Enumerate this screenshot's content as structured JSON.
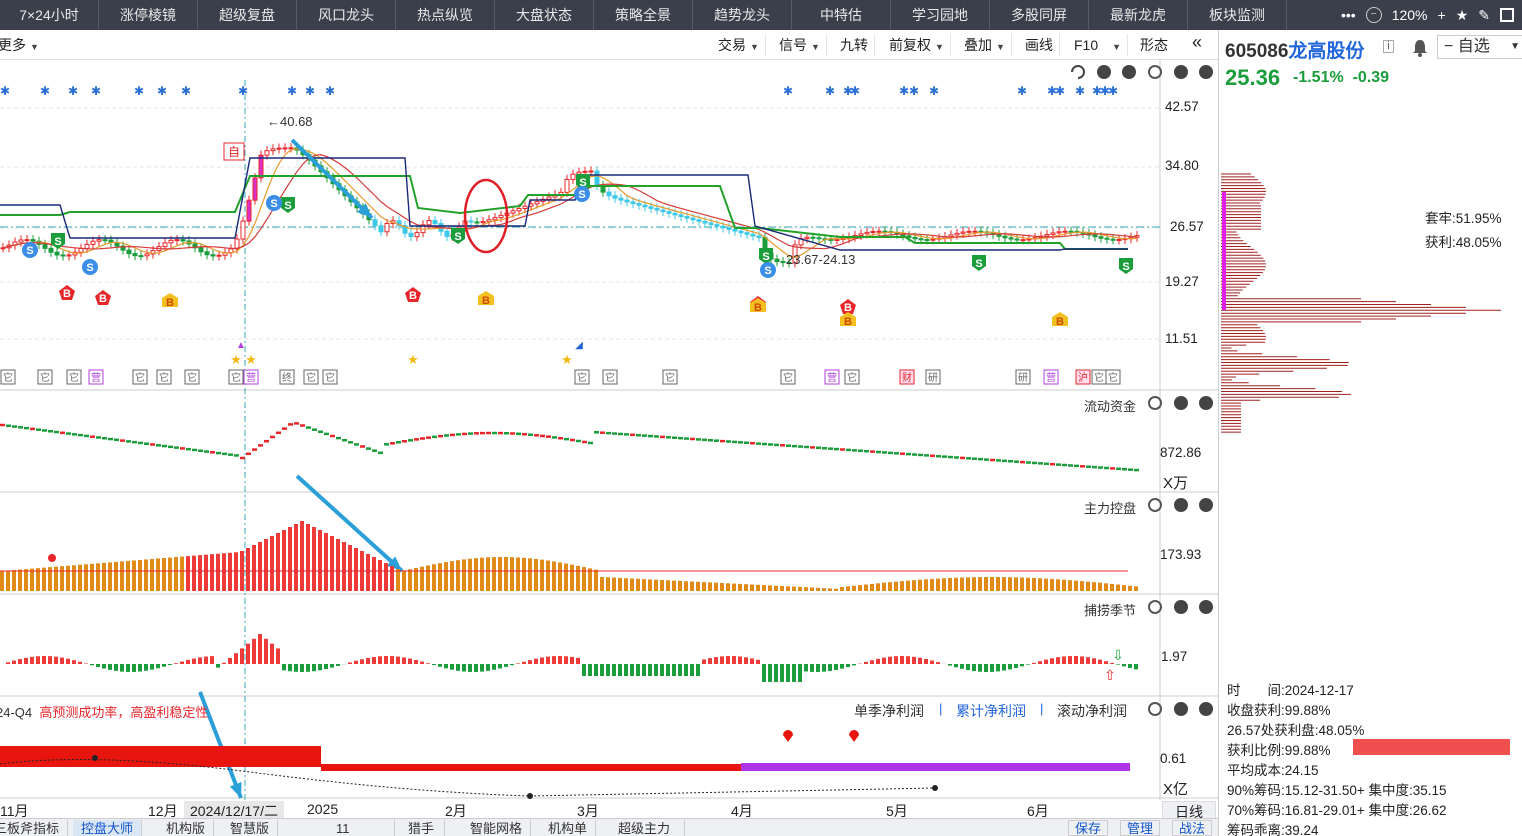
{
  "topnav": {
    "items": [
      "7×24小时",
      "涨停棱镜",
      "超级复盘",
      "风口龙头",
      "热点纵览",
      "大盘状态",
      "策略全景",
      "趋势龙头",
      "中特估",
      "学习园地",
      "多股同屏",
      "最新龙虎",
      "板块监测"
    ],
    "zoom": "120%"
  },
  "toolbar": {
    "more": "更多",
    "items": [
      "交易",
      "信号",
      "九转",
      "前复权",
      "叠加",
      "画线",
      "F10",
      "形态"
    ]
  },
  "stock": {
    "code": "605086",
    "name": "龙高股份",
    "price": "25.36",
    "change_pct": "-1.51%",
    "change": "-0.39",
    "watch_label": "自选",
    "info_badge": "i"
  },
  "main_chart": {
    "y_ticks": [
      "42.57",
      "34.80",
      "26.57",
      "19.27",
      "11.51"
    ],
    "high_label": "40.68",
    "low_label": "23.67-24.13",
    "signal_sell": "S",
    "signal_buy": "B",
    "signal_self": "自",
    "event_tags": [
      "它",
      "它",
      "它",
      "营",
      "它",
      "它",
      "它",
      "它",
      "营",
      "终",
      "它",
      "它",
      "它",
      "它",
      "它",
      "它",
      "营",
      "它",
      "财",
      "研",
      "研",
      "营",
      "沪",
      "它",
      "它"
    ]
  },
  "chip": {
    "trap_label": "套牢:51.95%",
    "profit_label": "获利:48.05%"
  },
  "panes": {
    "flow": {
      "title": "流动资金",
      "value": "872.86",
      "unit": "X万"
    },
    "control": {
      "title": "主力控盘",
      "value": "173.93"
    },
    "season": {
      "title": "捕捞季节",
      "value": "1.97"
    },
    "profit": {
      "title_left": "24-Q4",
      "title_highlight": "高预测成功率，高盈利稳定性",
      "tabs": [
        "单季净利润",
        "累计净利润",
        "滚动净利润"
      ],
      "value": "0.61",
      "unit": "X亿"
    }
  },
  "x_axis": {
    "labels": [
      "11月",
      "12月",
      "2024/12/17/二",
      "2025",
      "2月",
      "3月",
      "4月",
      "5月",
      "6月"
    ],
    "period_btn": "日线"
  },
  "chip_stats": {
    "time_label": "时　　间:2024-12-17",
    "close_profit": "收盘获利:99.88%",
    "price_profit": "26.57处获利盘:48.05%",
    "profit_ratio": "获利比例:99.88%",
    "avg_cost": "平均成本:24.15",
    "chip90": "90%筹码:15.12-31.50+ 集中度:35.15",
    "chip70": "70%筹码:16.81-29.01+ 集中度:26.62",
    "chip_dev": "筹码乖离:39.24"
  },
  "bottom_tabs": [
    "三板斧指标",
    "控盘大师",
    "机构版",
    "智慧版",
    "11",
    "猎手",
    "智能网格",
    "机构单",
    "超级主力"
  ],
  "bottom_buttons": [
    "保存",
    "管理",
    "战法"
  ],
  "colors": {
    "up": "#e8262a",
    "down": "#1a9d3a",
    "accent": "#2266dd",
    "nav_bg": "#3a3f4b"
  }
}
